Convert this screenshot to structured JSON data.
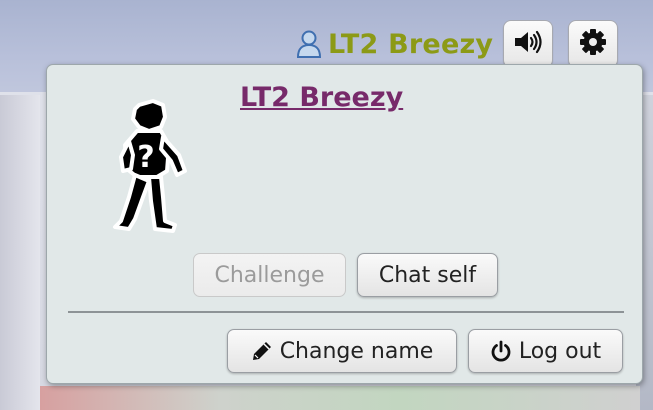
{
  "topbar": {
    "username": "LT2 Breezy",
    "user_icon": "user-icon",
    "sound_icon": "speaker-volume-icon",
    "settings_icon": "gear-icon"
  },
  "popup": {
    "title": "LT2 Breezy",
    "avatar_icon": "unknown-trainer-silhouette",
    "challenge_label": "Challenge",
    "chat_self_label": "Chat self",
    "change_name_label": "Change name",
    "change_name_icon": "pencil-icon",
    "log_out_label": "Log out",
    "log_out_icon": "power-icon"
  },
  "colors": {
    "username": "#8c9a16",
    "title": "#772a6a",
    "popup_bg": "#e1e8e8"
  }
}
